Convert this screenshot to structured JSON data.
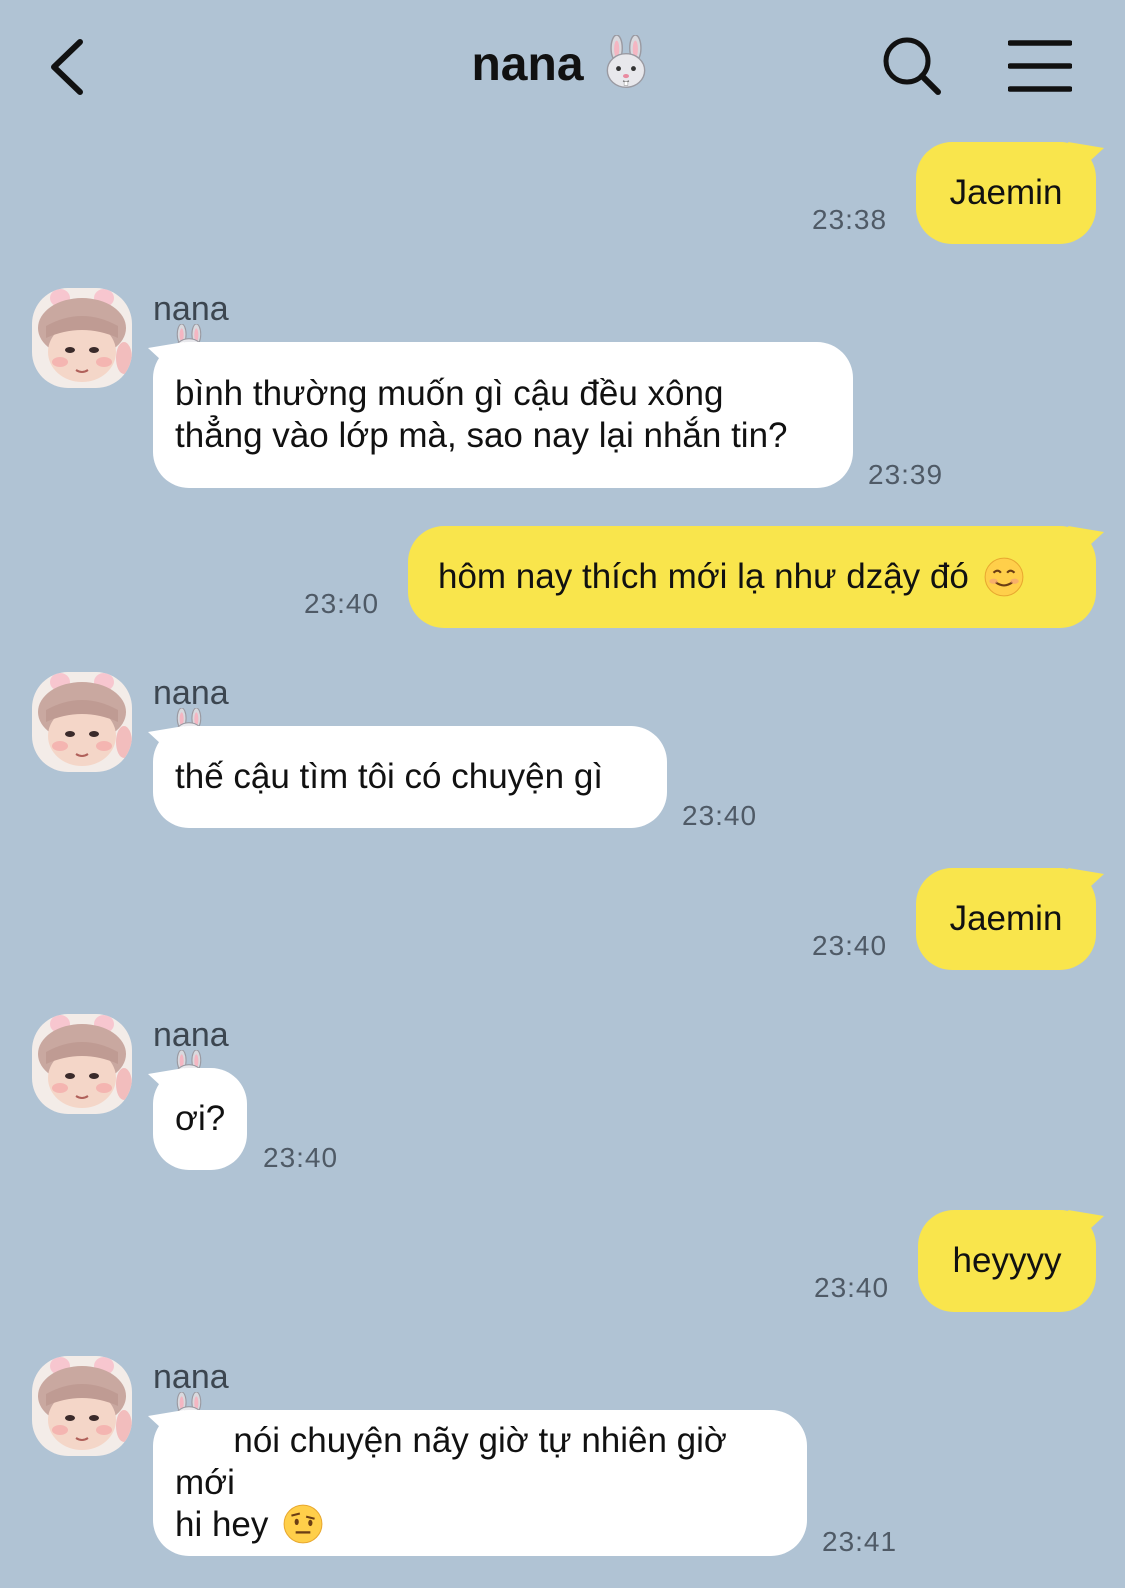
{
  "header": {
    "title": "nana",
    "title_emoji_name": "bunny-face-icon"
  },
  "contact": {
    "name": "nana"
  },
  "colors": {
    "background": "#b0c3d4",
    "my_bubble": "#f9e54c",
    "their_bubble": "#ffffff",
    "timestamp": "#4f5a66"
  },
  "messages": [
    {
      "from": "me",
      "text": "Jaemin",
      "time": "23:38"
    },
    {
      "from": "them",
      "sender": "nana",
      "text": "bình thường muốn gì cậu đều xông\nthẳng vào lớp mà, sao nay lại nhắn tin?",
      "time": "23:39"
    },
    {
      "from": "me",
      "text": "hôm nay thích mới lạ như dzậy đó",
      "emoji": "smiling-face-icon",
      "time": "23:40"
    },
    {
      "from": "them",
      "sender": "nana",
      "text": "thế cậu tìm tôi có chuyện gì",
      "time": "23:40"
    },
    {
      "from": "me",
      "text": "Jaemin",
      "time": "23:40"
    },
    {
      "from": "them",
      "sender": "nana",
      "text": "ơi?",
      "time": "23:40"
    },
    {
      "from": "me",
      "text": "heyyyy",
      "time": "23:40"
    },
    {
      "from": "them",
      "sender": "nana",
      "text": "nói chuyện nãy giờ tự nhiên giờ mới\nhi hey",
      "emoji": "raised-eyebrow-face-icon",
      "time": "23:41"
    }
  ]
}
